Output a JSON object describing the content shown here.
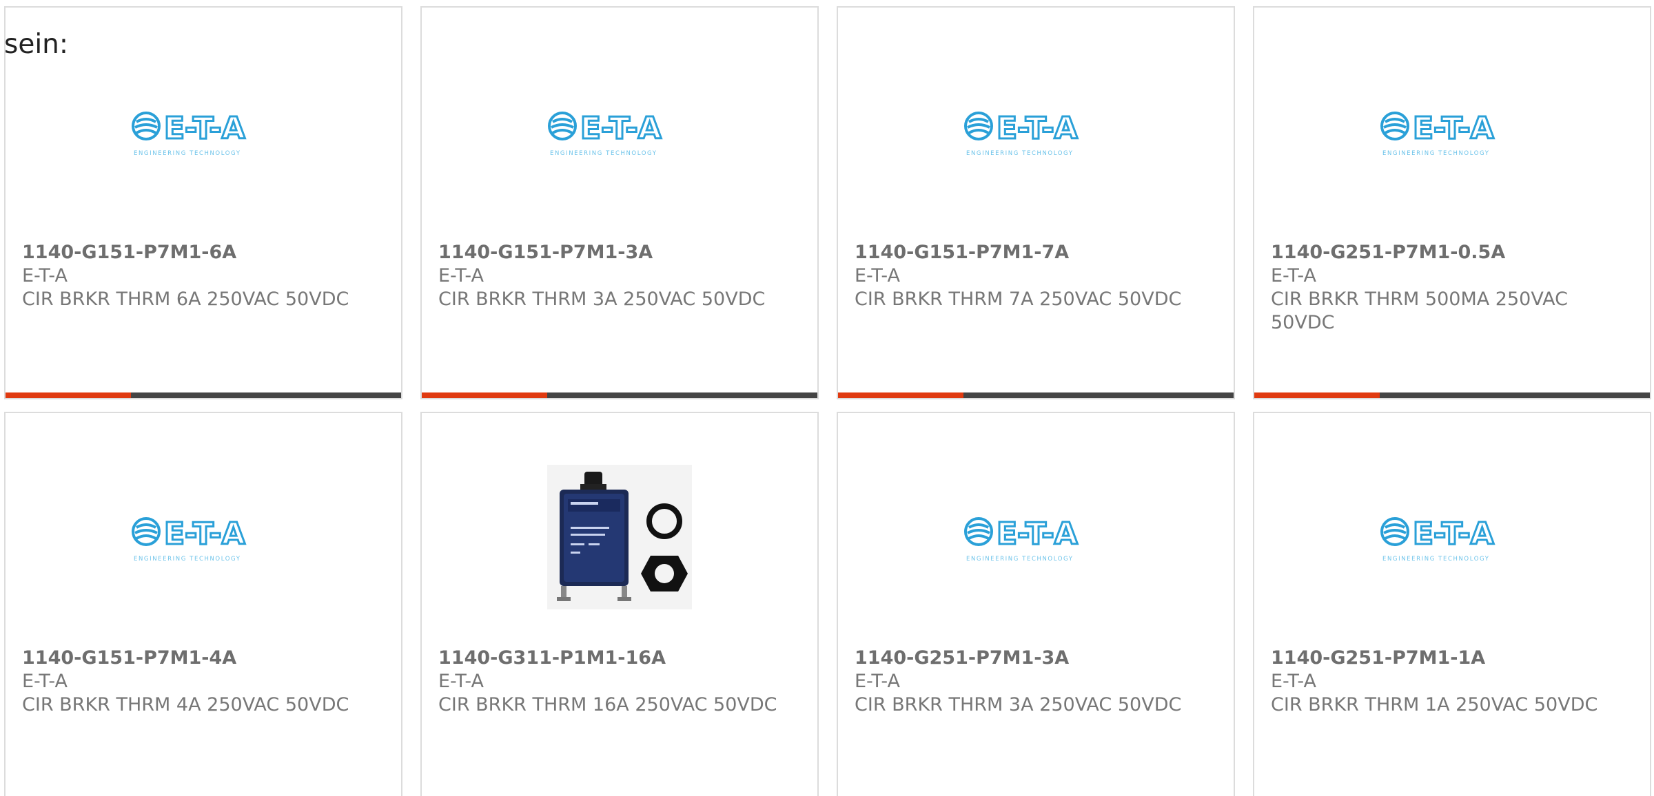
{
  "intro_text": "sein:",
  "colors": {
    "accent": "#e03a10",
    "bar": "#444444",
    "logo": "#2aa0d8"
  },
  "logo": {
    "brand": "E-T-A",
    "tagline": "ENGINEERING TECHNOLOGY"
  },
  "products": [
    {
      "part_number": "1140-G151-P7M1-6A",
      "manufacturer": "E-T-A",
      "description": "CIR BRKR THRM 6A 250VAC 50VDC",
      "image": "eta-logo"
    },
    {
      "part_number": "1140-G151-P7M1-3A",
      "manufacturer": "E-T-A",
      "description": "CIR BRKR THRM 3A 250VAC 50VDC",
      "image": "eta-logo"
    },
    {
      "part_number": "1140-G151-P7M1-7A",
      "manufacturer": "E-T-A",
      "description": "CIR BRKR THRM 7A 250VAC 50VDC",
      "image": "eta-logo"
    },
    {
      "part_number": "1140-G251-P7M1-0.5A",
      "manufacturer": "E-T-A",
      "description": "CIR BRKR THRM 500MA 250VAC 50VDC",
      "image": "eta-logo"
    },
    {
      "part_number": "1140-G151-P7M1-4A",
      "manufacturer": "E-T-A",
      "description": "CIR BRKR THRM 4A 250VAC 50VDC",
      "image": "eta-logo"
    },
    {
      "part_number": "1140-G311-P1M1-16A",
      "manufacturer": "E-T-A",
      "description": "CIR BRKR THRM 16A 250VAC 50VDC",
      "image": "circuit-breaker-photo"
    },
    {
      "part_number": "1140-G251-P7M1-3A",
      "manufacturer": "E-T-A",
      "description": "CIR BRKR THRM 3A 250VAC 50VDC",
      "image": "eta-logo"
    },
    {
      "part_number": "1140-G251-P7M1-1A",
      "manufacturer": "E-T-A",
      "description": "CIR BRKR THRM 1A 250VAC 50VDC",
      "image": "eta-logo"
    }
  ]
}
